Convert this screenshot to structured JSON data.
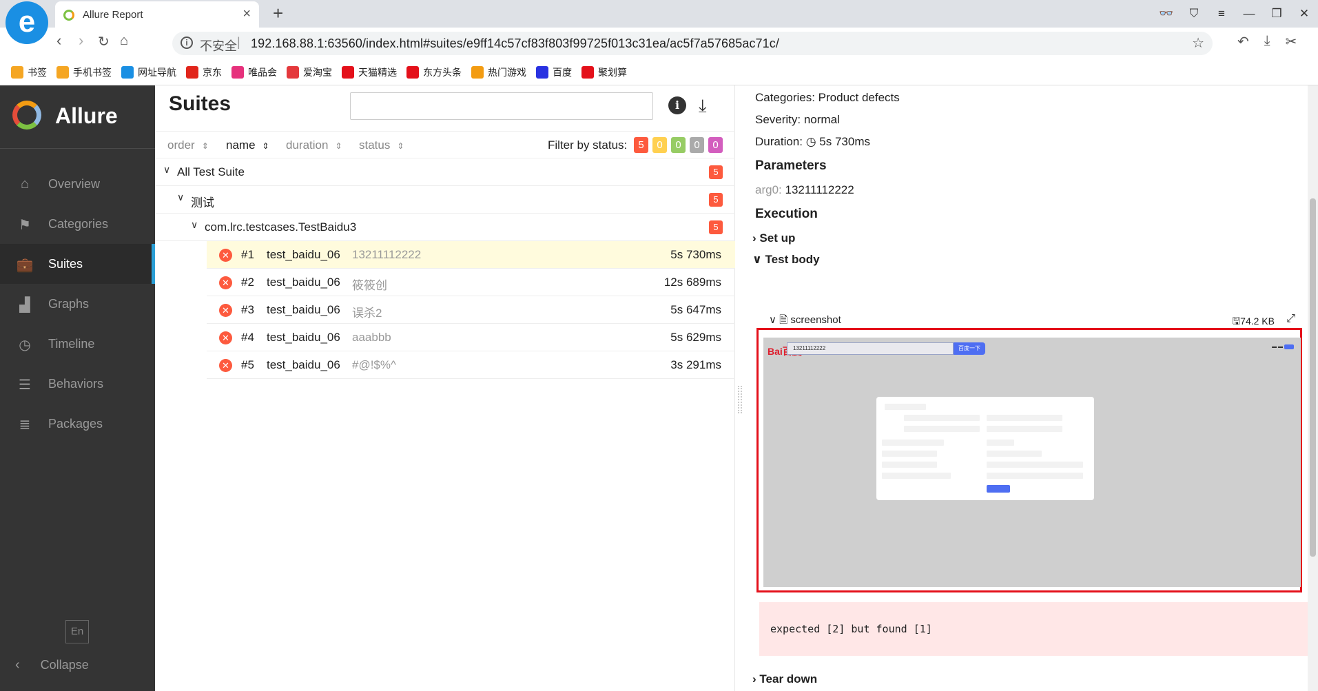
{
  "browser": {
    "tab_title": "Allure Report",
    "insecure_label": "不安全",
    "url": "192.168.88.1:63560/index.html#suites/e9ff14c57cf83f803f99725f013c31ea/ac5f7a57685ac71c/",
    "bookmarks": [
      {
        "label": "书签",
        "icon": "star-icon",
        "color": "#f5a623"
      },
      {
        "label": "手机书签",
        "icon": "phone-icon",
        "color": "#f5a623"
      },
      {
        "label": "网址导航",
        "icon": "compass-icon",
        "color": "#1a8fe3"
      },
      {
        "label": "京东",
        "icon": "jd-icon",
        "color": "#e1251b"
      },
      {
        "label": "唯品会",
        "icon": "vip-icon",
        "color": "#e6317c"
      },
      {
        "label": "爱淘宝",
        "icon": "taobao-icon",
        "color": "#e4393c"
      },
      {
        "label": "天猫精选",
        "icon": "tmall-icon",
        "color": "#e4101a"
      },
      {
        "label": "东方头条",
        "icon": "news-icon",
        "color": "#e4101a"
      },
      {
        "label": "热门游戏",
        "icon": "game-icon",
        "color": "#f39c12"
      },
      {
        "label": "百度",
        "icon": "paw-icon",
        "color": "#2932e1"
      },
      {
        "label": "聚划算",
        "icon": "juhuasuan-icon",
        "color": "#e4101a"
      }
    ]
  },
  "sidebar": {
    "brand": "Allure",
    "items": [
      {
        "label": "Overview",
        "icon": "home-icon"
      },
      {
        "label": "Categories",
        "icon": "flag-icon"
      },
      {
        "label": "Suites",
        "icon": "briefcase-icon"
      },
      {
        "label": "Graphs",
        "icon": "bar-chart-icon"
      },
      {
        "label": "Timeline",
        "icon": "clock-icon"
      },
      {
        "label": "Behaviors",
        "icon": "list-icon"
      },
      {
        "label": "Packages",
        "icon": "align-left-icon"
      }
    ],
    "active": "Suites",
    "lang": "En",
    "collapse": "Collapse"
  },
  "main": {
    "title": "Suites",
    "sort": {
      "order": "order",
      "name": "name",
      "duration": "duration",
      "status": "status"
    },
    "filter_label": "Filter by status:",
    "status_counts": [
      {
        "value": "5",
        "color": "#fd5a3e"
      },
      {
        "value": "0",
        "color": "#ffd050"
      },
      {
        "value": "0",
        "color": "#97cc64"
      },
      {
        "value": "0",
        "color": "#aaaaaa"
      },
      {
        "value": "0",
        "color": "#d35ebe"
      }
    ],
    "tree": [
      {
        "label": "All Test Suite",
        "count": "5"
      },
      {
        "label": "测试",
        "count": "5"
      },
      {
        "label": "com.lrc.testcases.TestBaidu3",
        "count": "5"
      }
    ],
    "cases": [
      {
        "num": "#1",
        "name": "test_baidu_06",
        "param": "13211112222",
        "duration": "5s 730ms"
      },
      {
        "num": "#2",
        "name": "test_baidu_06",
        "param": "筱筱创",
        "duration": "12s 689ms"
      },
      {
        "num": "#3",
        "name": "test_baidu_06",
        "param": "误杀2",
        "duration": "5s 647ms"
      },
      {
        "num": "#4",
        "name": "test_baidu_06",
        "param": "aaabbb",
        "duration": "5s 629ms"
      },
      {
        "num": "#5",
        "name": "test_baidu_06",
        "param": "#@!$%^",
        "duration": "3s 291ms"
      }
    ]
  },
  "detail": {
    "categories": "Categories: Product defects",
    "severity": "Severity: normal",
    "duration_label": "Duration:",
    "duration": "5s 730ms",
    "parameters_title": "Parameters",
    "param_key": "arg0:",
    "param_value": "13211112222",
    "execution_title": "Execution",
    "set_up": "Set up",
    "test_body": "Test body",
    "attachment_name": "screenshot",
    "attachment_size": "74.2 KB",
    "screenshot": {
      "search_value": "13211112222",
      "button": "百度一下"
    },
    "error": "expected [2] but found [1]",
    "tear_down": "Tear down"
  }
}
